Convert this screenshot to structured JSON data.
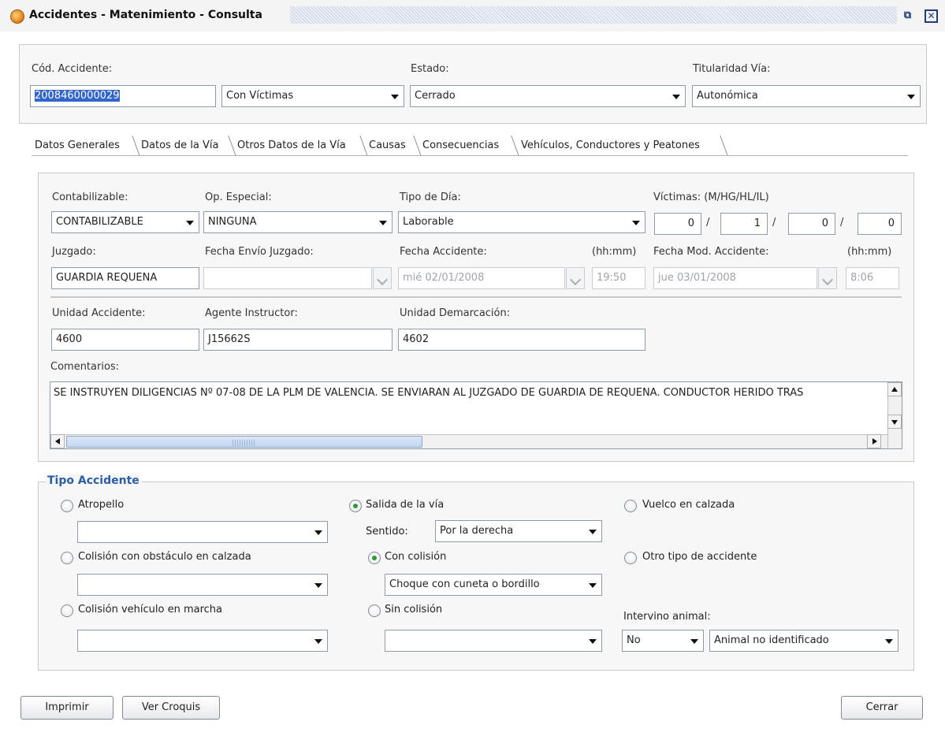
{
  "window": {
    "title": "Accidentes - Matenimiento - Consulta",
    "restore_icon": "restore-icon",
    "close_icon": "close-icon"
  },
  "header": {
    "cod_label": "Cód. Accidente:",
    "cod_value": "2008460000029",
    "victimas_combo": "Con Víctimas",
    "estado_label": "Estado:",
    "estado_value": "Cerrado",
    "titularidad_label": "Titularidad Vía:",
    "titularidad_value": "Autonómica"
  },
  "tabs": [
    {
      "label": "Datos Generales"
    },
    {
      "label": "Datos de la Vía"
    },
    {
      "label": "Otros Datos de la Vía"
    },
    {
      "label": "Causas"
    },
    {
      "label": "Consecuencias"
    },
    {
      "label": "Vehículos, Conductores y Peatones"
    }
  ],
  "general": {
    "contabilizable_label": "Contabilizable:",
    "contabilizable_value": "CONTABILIZABLE",
    "op_especial_label": "Op. Especial:",
    "op_especial_value": "NINGUNA",
    "tipo_dia_label": "Tipo de Día:",
    "tipo_dia_value": "Laborable",
    "victimas_label": "Víctimas: (M/HG/HL/IL)",
    "victimas": [
      "0",
      "1",
      "0",
      "0"
    ],
    "juzgado_label": "Juzgado:",
    "juzgado_value": "GUARDIA REQUENA",
    "fecha_envio_label": "Fecha Envío Juzgado:",
    "fecha_envio_value": "",
    "fecha_acc_label": "Fecha Accidente:",
    "fecha_acc_value": "mié 02/01/2008",
    "hhmm_label": "(hh:mm)",
    "hora_acc_value": "19:50",
    "fecha_mod_label": "Fecha Mod. Accidente:",
    "fecha_mod_value": "jue 03/01/2008",
    "hhmm_label2": "(hh:mm)",
    "hora_mod_value": "8:06",
    "unidad_label": "Unidad Accidente:",
    "unidad_value": "4600",
    "agente_label": "Agente Instructor:",
    "agente_value": "J15662S",
    "demarcacion_label": "Unidad Demarcación:",
    "demarcacion_value": "4602",
    "comentarios_label": "Comentarios:",
    "comentarios_value": "SE INSTRUYEN DILIGENCIAS Nº 07-08 DE LA PLM DE VALENCIA. SE ENVIARAN AL JUZGADO DE GUARDIA DE REQUENA. CONDUCTOR HERIDO TRAS"
  },
  "tipo_accidente": {
    "legend": "Tipo Accidente",
    "atropello": "Atropello",
    "colision_obstaculo": "Colisión con obstáculo en calzada",
    "colision_vehiculo": "Colisión vehículo en marcha",
    "salida_via": "Salida de la vía",
    "sentido_label": "Sentido:",
    "sentido_value": "Por la derecha",
    "con_colision": "Con colisión",
    "con_colision_value": "Choque con cuneta o bordillo",
    "sin_colision": "Sin colisión",
    "vuelco": "Vuelco en calzada",
    "otro_tipo": "Otro tipo de accidente",
    "animal_label": "Intervino animal:",
    "animal_value": "No",
    "animal_tipo_value": "Animal no identificado"
  },
  "footer": {
    "imprimir": "Imprimir",
    "ver_croquis": "Ver Croquis",
    "cerrar": "Cerrar"
  }
}
